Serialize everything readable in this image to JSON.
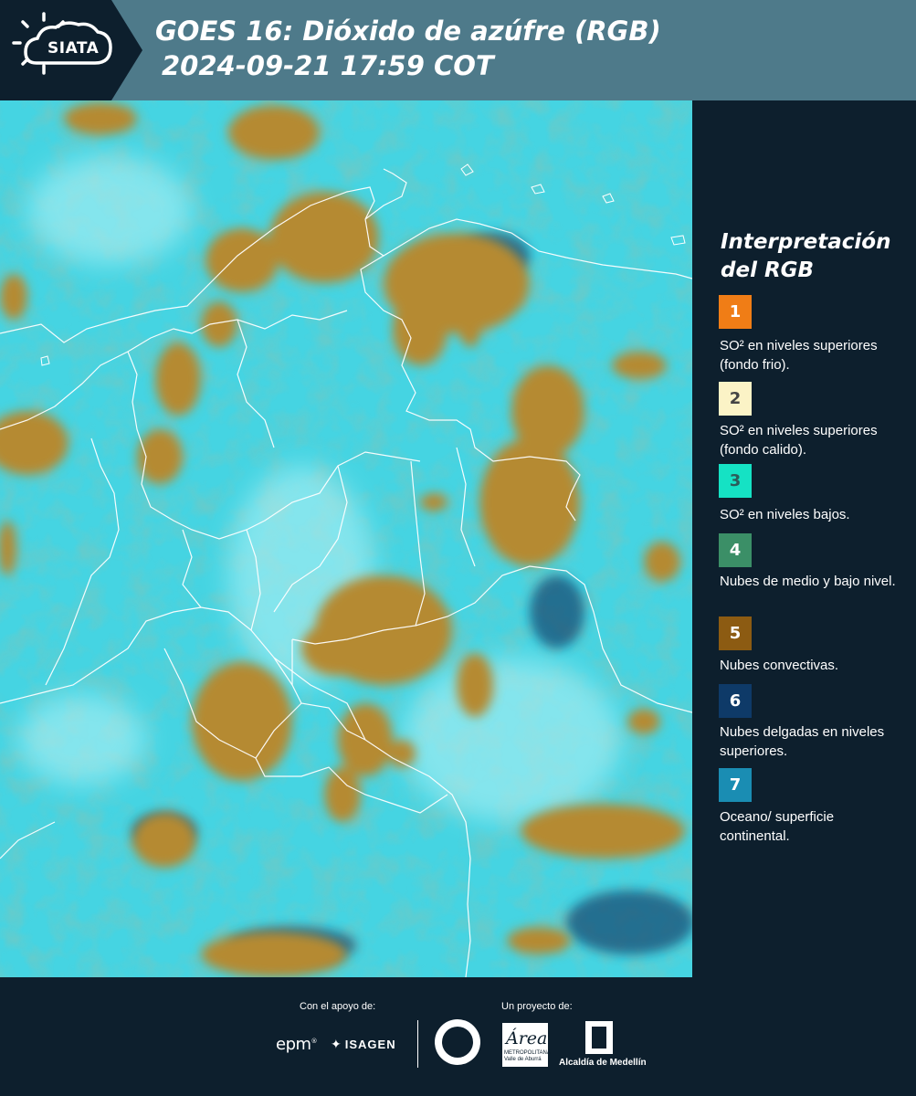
{
  "header": {
    "brand": "SIATA",
    "title_line1": "GOES 16: Dióxido de azúfre (RGB)",
    "title_line2": "2024-09-21 17:59 COT",
    "background_color": "#4e7a8a"
  },
  "map": {
    "description_icon": "satellite-rgb-image",
    "colors": {
      "surface_cyan": "#3fd9e6",
      "convective_brown": "#b08a2e",
      "mid_low_green": "#4fa88a",
      "borders": "#ffffff"
    }
  },
  "legend": {
    "title": "Interpretación del RGB",
    "items": [
      {
        "number": "1",
        "text": "SO² en niveles superiores (fondo frio).",
        "color": "#f07d16",
        "text_color": "#ffffff"
      },
      {
        "number": "2",
        "text": "SO² en niveles superiores (fondo calido).",
        "color": "#fbf3c6",
        "text_color": "#444444"
      },
      {
        "number": "3",
        "text": "SO² en niveles bajos.",
        "color": "#15e2c4",
        "text_color": "#2b5d5a"
      },
      {
        "number": "4",
        "text": "Nubes de medio y bajo nivel.",
        "color": "#3b8f67",
        "text_color": "#ffffff"
      },
      {
        "number": "5",
        "text": "Nubes convectivas.",
        "color": "#8c5b12",
        "text_color": "#ffffff"
      },
      {
        "number": "6",
        "text": "Nubes delgadas en niveles superiores.",
        "color": "#0e3a68",
        "text_color": "#ffffff"
      },
      {
        "number": "7",
        "text": "Oceano/ superficie continental.",
        "color": "#1a8db3",
        "text_color": "#ffffff"
      }
    ]
  },
  "footer": {
    "support_caption": "Con el apoyo de:",
    "project_caption": "Un proyecto de:",
    "epm": "epm",
    "isagen": "ISAGEN",
    "area_word": "Área",
    "area_sub": "METROPOLITANA Valle de Aburrá",
    "alcaldia": "Alcaldía de Medellín"
  }
}
